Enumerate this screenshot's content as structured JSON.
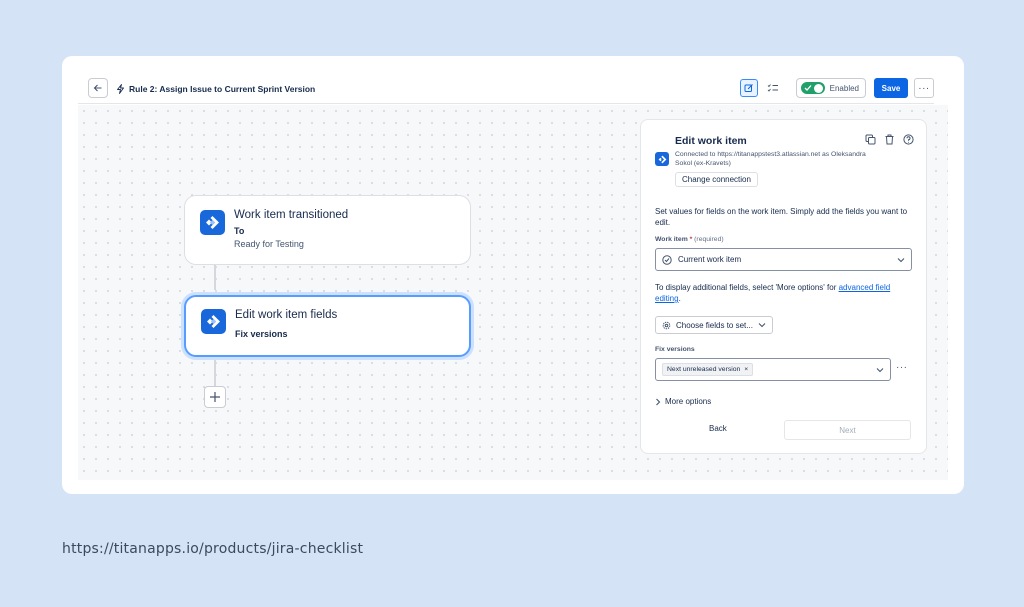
{
  "header": {
    "rule_title": "Rule 2: Assign Issue to Current Sprint Version",
    "enabled_label": "Enabled",
    "save_label": "Save",
    "more_label": "···"
  },
  "flow": {
    "nodes": [
      {
        "title": "Work item transitioned",
        "subtitle": "To",
        "detail": "Ready for Testing"
      },
      {
        "title": "Edit work item fields",
        "subtitle": "Fix versions"
      }
    ],
    "add_label": "+"
  },
  "panel": {
    "title": "Edit work item",
    "connection_text": "Connected to https://titanappstest3.atlassian.net as Oleksandra Sokol (ex-Kravets)",
    "change_connection_label": "Change connection",
    "description": "Set values for fields on the work item. Simply add the fields you want to edit.",
    "work_item_label": "Work item",
    "required_mark": "*",
    "required_text": "(required)",
    "work_item_value": "Current work item",
    "info_text": "To display additional fields, select 'More options' for ",
    "info_link": "advanced field editing",
    "info_end": ".",
    "choose_fields_label": "Choose fields to set...",
    "fix_versions_label": "Fix versions",
    "fix_versions_tag": "Next unreleased version",
    "tag_remove": "×",
    "field_more": "···",
    "more_options_label": "More options",
    "back_label": "Back",
    "next_label": "Next"
  },
  "footer": {
    "url": "https://titanapps.io/products/jira-checklist"
  },
  "colors": {
    "background": "#d5e3f7",
    "primary": "#0c66e4",
    "toggle_on": "#22a06b",
    "jira_blue": "#1868db"
  }
}
